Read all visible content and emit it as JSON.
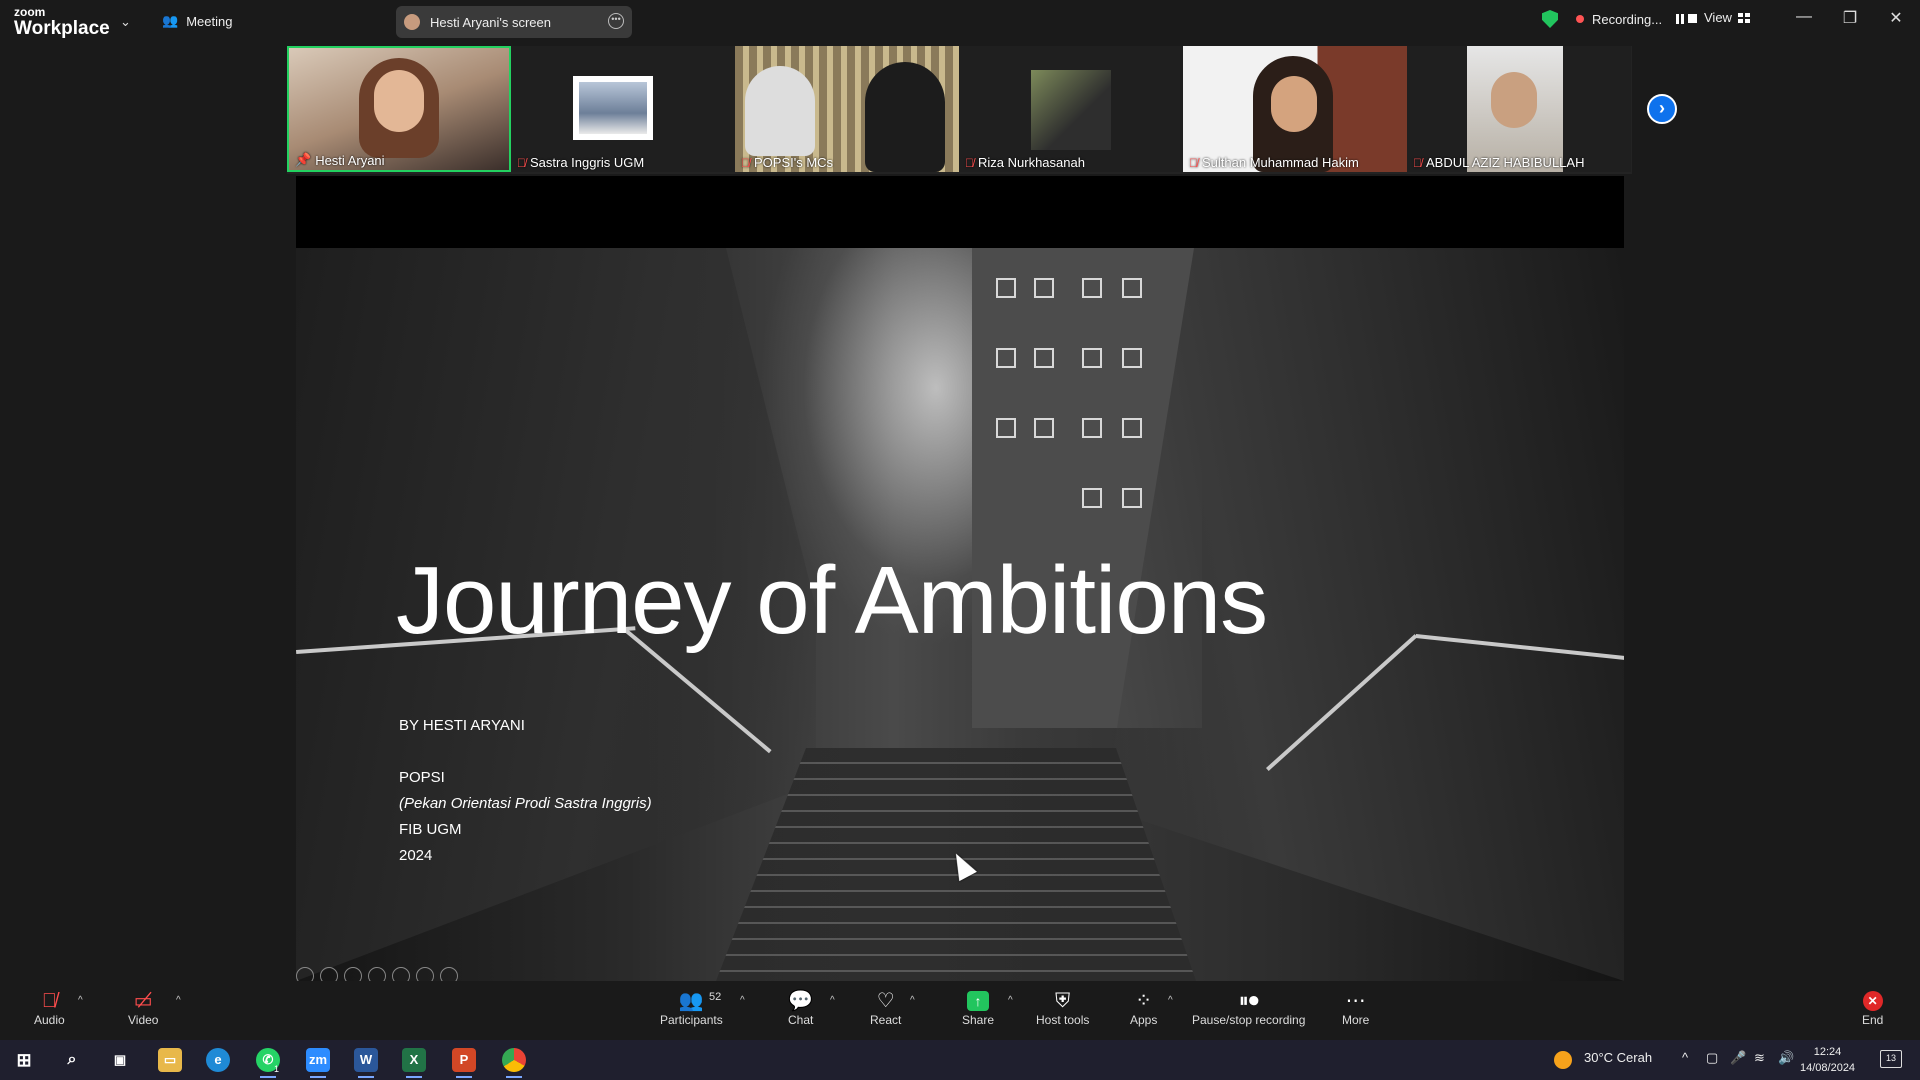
{
  "app": {
    "brand_small": "zoom",
    "brand_large": "Workplace",
    "meeting_label": "Meeting"
  },
  "screen_tab": {
    "label": "Hesti Aryani's screen"
  },
  "recording": {
    "label": "Recording...",
    "view_label": "View"
  },
  "participants_strip": [
    {
      "name": "Hesti Aryani",
      "muted": false,
      "pinned": true,
      "active": true
    },
    {
      "name": "Sastra Inggris UGM",
      "muted": true
    },
    {
      "name": "POPSI's MCs",
      "muted": true
    },
    {
      "name": "Riza Nurkhasanah",
      "muted": true
    },
    {
      "name": "Sulthan Muhammad Hakim",
      "muted": true
    },
    {
      "name": "ABDUL AZIZ HABIBULLAH",
      "muted": true
    }
  ],
  "slide": {
    "title": "Journey of Ambitions",
    "byline": "BY HESTI ARYANI",
    "line1": "POPSI",
    "line2": "(Pekan Orientasi Prodi Sastra Inggris)",
    "line3": "FIB UGM",
    "line4": "2024"
  },
  "toolbar": {
    "audio": "Audio",
    "video": "Video",
    "participants": "Participants",
    "participants_count": "52",
    "chat": "Chat",
    "react": "React",
    "share": "Share",
    "host_tools": "Host tools",
    "apps": "Apps",
    "pause_stop": "Pause/stop recording",
    "more": "More",
    "end": "End"
  },
  "taskbar": {
    "weather": "30°C  Cerah",
    "time": "12:24",
    "date": "14/08/2024",
    "whatsapp_badge": "1",
    "notif_count": "13"
  },
  "colors": {
    "accent_green": "#22c55e",
    "recording_red": "#ff5454",
    "zoom_blue": "#0e72ed",
    "end_red": "#e02828"
  }
}
